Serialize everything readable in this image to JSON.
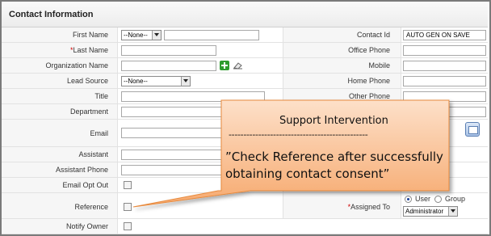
{
  "section": {
    "title": "Contact Information"
  },
  "left_fields": {
    "first_name": {
      "label": "First Name",
      "salutation": "--None--"
    },
    "last_name": {
      "label": "Last Name",
      "required_mark": "*"
    },
    "organization_name": {
      "label": "Organization Name"
    },
    "lead_source": {
      "label": "Lead Source",
      "value": "--None--"
    },
    "title": {
      "label": "Title"
    },
    "department": {
      "label": "Department"
    },
    "email": {
      "label": "Email"
    },
    "assistant": {
      "label": "Assistant"
    },
    "assistant_phone": {
      "label": "Assistant Phone"
    },
    "email_opt_out": {
      "label": "Email Opt Out"
    },
    "reference": {
      "label": "Reference"
    },
    "notify_owner": {
      "label": "Notify Owner"
    }
  },
  "right_fields": {
    "contact_id": {
      "label": "Contact Id",
      "value": "AUTO GEN ON SAVE"
    },
    "office_phone": {
      "label": "Office Phone"
    },
    "mobile": {
      "label": "Mobile"
    },
    "home_phone": {
      "label": "Home Phone"
    },
    "other_phone": {
      "label": "Other Phone"
    },
    "assigned_to": {
      "label": "Assigned To",
      "required_mark": "*",
      "option_user": "User",
      "option_group": "Group",
      "selected_option": "User",
      "value": "Administrator"
    }
  },
  "callout": {
    "title": "Support  Intervention",
    "divider": "-----------------------------------------------",
    "line1": "”Check Reference after successfully",
    "line2": "obtaining contact consent”",
    "fill_top": "#fde0c9",
    "fill_bottom": "#f6a96e",
    "stroke": "#e88a3e"
  },
  "icons": {
    "organization_add": "plus-icon",
    "organization_clear": "eraser-icon",
    "calendar": "calendar-icon"
  }
}
